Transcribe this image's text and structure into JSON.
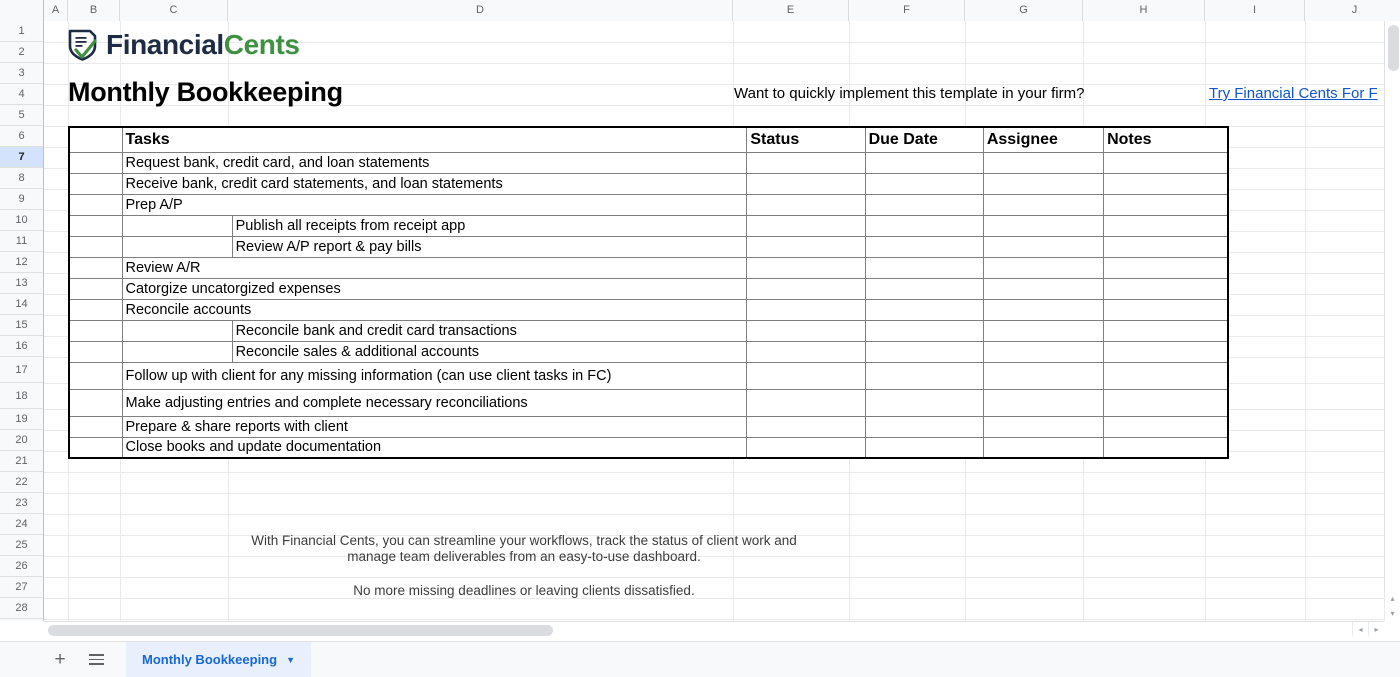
{
  "app": {
    "type": "spreadsheet",
    "column_headers": [
      "A",
      "B",
      "C",
      "D",
      "E",
      "F",
      "G",
      "H",
      "I",
      "J"
    ],
    "row_headers": [
      "1",
      "2",
      "3",
      "4",
      "5",
      "6",
      "7",
      "8",
      "9",
      "10",
      "11",
      "12",
      "13",
      "14",
      "15",
      "16",
      "17",
      "18",
      "19",
      "20",
      "21",
      "22",
      "23",
      "24",
      "25",
      "26",
      "27",
      "28"
    ],
    "active_row": "7"
  },
  "branding": {
    "logo_icon": "financial-cents-shield-check-icon",
    "logo_part1": "Financial",
    "logo_part2": "Cents",
    "color_dark": "#1d2b44",
    "color_green": "#3f9142"
  },
  "header": {
    "title": "Monthly Bookkeeping",
    "cta_question": "Want to quickly implement this template in your firm?",
    "cta_link": "Try Financial Cents For F",
    "cta_link_color": "#1155cc"
  },
  "table": {
    "columns": [
      "Tasks",
      "Status",
      "Due Date",
      "Assignee",
      "Notes"
    ],
    "rows": [
      {
        "level": 1,
        "task": "Request bank, credit card, and loan statements",
        "status": "",
        "due_date": "",
        "assignee": "",
        "notes": ""
      },
      {
        "level": 1,
        "task": "Receive bank, credit card statements, and loan statements",
        "status": "",
        "due_date": "",
        "assignee": "",
        "notes": ""
      },
      {
        "level": 1,
        "task": "Prep A/P",
        "status": "",
        "due_date": "",
        "assignee": "",
        "notes": ""
      },
      {
        "level": 2,
        "task": "Publish all receipts from receipt app",
        "status": "",
        "due_date": "",
        "assignee": "",
        "notes": ""
      },
      {
        "level": 2,
        "task": "Review A/P report & pay bills",
        "status": "",
        "due_date": "",
        "assignee": "",
        "notes": ""
      },
      {
        "level": 1,
        "task": "Review A/R",
        "status": "",
        "due_date": "",
        "assignee": "",
        "notes": ""
      },
      {
        "level": 1,
        "task": "Catorgize uncatorgized expenses",
        "status": "",
        "due_date": "",
        "assignee": "",
        "notes": ""
      },
      {
        "level": 1,
        "task": "Reconcile accounts",
        "status": "",
        "due_date": "",
        "assignee": "",
        "notes": ""
      },
      {
        "level": 2,
        "task": "Reconcile bank and credit card transactions",
        "status": "",
        "due_date": "",
        "assignee": "",
        "notes": ""
      },
      {
        "level": 2,
        "task": "Reconcile sales & additional accounts",
        "status": "",
        "due_date": "",
        "assignee": "",
        "notes": ""
      },
      {
        "level": 1,
        "task": "Follow up with client for any missing information (can use client tasks in FC)",
        "status": "",
        "due_date": "",
        "assignee": "",
        "notes": ""
      },
      {
        "level": 1,
        "task": "Make adjusting entries and complete necessary reconciliations",
        "status": "",
        "due_date": "",
        "assignee": "",
        "notes": ""
      },
      {
        "level": 1,
        "task": "Prepare & share reports with client",
        "status": "",
        "due_date": "",
        "assignee": "",
        "notes": ""
      },
      {
        "level": 1,
        "task": "Close books and update documentation",
        "status": "",
        "due_date": "",
        "assignee": "",
        "notes": ""
      }
    ]
  },
  "footer": {
    "paragraph1": "With Financial Cents, you can streamline your workflows, track the status of client work and manage team deliverables from an easy-to-use dashboard.",
    "paragraph2": "No more missing deadlines or leaving clients dissatisfied."
  },
  "tabbar": {
    "add_sheet_label": "+",
    "all_sheets_icon": "hamburger-menu-icon",
    "active_sheet": "Monthly Bookkeeping",
    "sheet_menu_icon": "chevron-down-icon"
  },
  "scroll": {
    "left_arrow": "◂",
    "right_arrow": "▸",
    "up_arrow": "▴",
    "down_arrow": "▾"
  }
}
